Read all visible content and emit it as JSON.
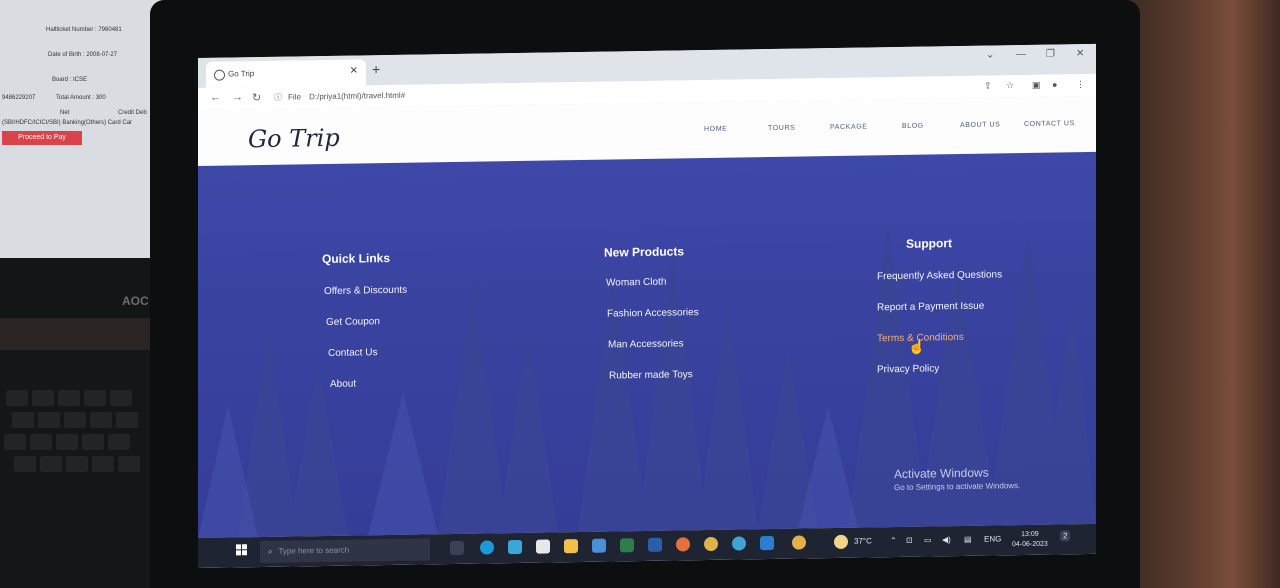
{
  "background_screen": {
    "hallticket": "Hallticket Number : 7960481",
    "dob": "Date of Birth : 2008-07-27",
    "board": "Board : ICSE",
    "number": "9486229207",
    "total": "Total Amount : 300",
    "net": "Net",
    "credit": "Credit Deb",
    "banking": "(SBI/HDFC/ICICI/SBI) Banking(Others) Card Car",
    "proceed_label": "Proceed to Pay",
    "monitor_brand": "AOC"
  },
  "browser": {
    "tab_title": "Go Trip",
    "url_scheme": "File",
    "url": "D:/priya1(html)/travel.html#"
  },
  "site": {
    "logo": "Go Trip",
    "nav": [
      "HOME",
      "TOURS",
      "PACKAGE",
      "BLOG",
      "ABOUT US",
      "CONTACT US"
    ]
  },
  "footer": {
    "quick_links": {
      "title": "Quick Links",
      "items": [
        "Offers & Discounts",
        "Get Coupon",
        "Contact Us",
        "About"
      ]
    },
    "new_products": {
      "title": "New Products",
      "items": [
        "Woman Cloth",
        "Fashion Accessories",
        "Man Accessories",
        "Rubber made Toys"
      ]
    },
    "support": {
      "title": "Support",
      "items": [
        "Frequently Asked Questions",
        "Report a Payment Issue",
        "Terms & Conditions",
        "Privacy Policy"
      ],
      "highlighted": "Terms & Conditions"
    }
  },
  "watermark": {
    "line1": "Activate Windows",
    "line2": "Go to Settings to activate Windows."
  },
  "taskbar": {
    "search_placeholder": "Type here to search",
    "temperature": "37°C",
    "language": "ENG",
    "time": "13:09",
    "date": "04-06-2023",
    "notification_count": "2"
  },
  "colors": {
    "footer_bg": "#3e48a8",
    "highlight_link": "#f3b07a",
    "logo": "#1d2644"
  }
}
